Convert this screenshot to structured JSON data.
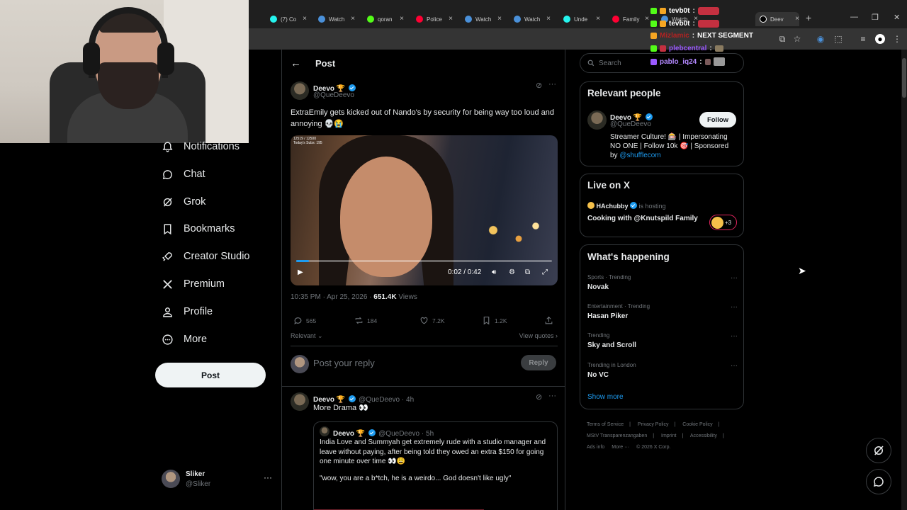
{
  "browser": {
    "tabs": [
      {
        "label": "(7) Co",
        "color": "#25f4ee"
      },
      {
        "label": "Watch",
        "color": "#53fc18"
      },
      {
        "label": "qoran",
        "color": "#53fc18"
      },
      {
        "label": "Police",
        "color": "#ff0033"
      },
      {
        "label": "Watch",
        "color": "#53fc18"
      },
      {
        "label": "Watch",
        "color": "#53fc18"
      },
      {
        "label": "Unde",
        "color": "#25f4ee"
      },
      {
        "label": "Family",
        "color": "#ff0033"
      },
      {
        "label": "Watch",
        "color": "#53fc18"
      },
      {
        "label": "Deev",
        "color": "#ffffff"
      }
    ]
  },
  "chat": [
    {
      "user": "tevb0t",
      "msg": "",
      "color": "#ffffff"
    },
    {
      "user": "tevb0t",
      "msg": "",
      "color": "#ffffff"
    },
    {
      "user": "Mizlamic",
      "msg": "NEXT SEGMENT",
      "color": "#b22222"
    },
    {
      "user": "plebcentral",
      "msg": "",
      "color": "#9b59ff"
    },
    {
      "user": "pablo_iq24",
      "msg": "",
      "color": "#b388ff"
    }
  ],
  "nav": {
    "notifications": "Notifications",
    "chat": "Chat",
    "grok": "Grok",
    "bookmarks": "Bookmarks",
    "creator_studio": "Creator Studio",
    "premium": "Premium",
    "profile": "Profile",
    "more": "More",
    "post_button": "Post"
  },
  "account": {
    "name": "Sliker",
    "handle": "@Sliker"
  },
  "main": {
    "header": "Post",
    "tweet": {
      "name": "Deevo 🏆",
      "handle": "@QueDeevo",
      "text": "ExtraEmily gets kicked out of Nando's by security for being way too loud and annoying 💀😭",
      "video_counter": "12519 / 12500",
      "video_subs": "Today's Subs: 195",
      "video_time": "0:02 / 0:42",
      "progress": 0.05,
      "timestamp": "10:35 PM · Apr 25, 2026 · ",
      "views": "651.4K",
      "views_label": " Views",
      "replies": "565",
      "reposts": "184",
      "likes": "7.2K",
      "bookmarks": "1.2K"
    },
    "sort_label": "Relevant",
    "view_quotes": "View quotes",
    "reply_placeholder": "Post your reply",
    "reply_button": "Reply",
    "reply_tweet": {
      "name": "Deevo 🏆",
      "handle": "@QueDeevo · 4h",
      "text": "More Drama 👀"
    },
    "quoted": {
      "name": "Deevo 🏆",
      "handle": "@QueDeevo · 5h",
      "text": "India Love and Summyah get extremely rude with a studio manager and leave without paying, after being told they owed an extra $150 for going one minute over time 👀😩",
      "quote_line": "\"wow, you are a b*tch, he is a weirdo... God doesn't like ugly\""
    }
  },
  "right": {
    "search_placeholder": "Search",
    "relevant_title": "Relevant people",
    "person": {
      "name": "Deevo 🏆",
      "handle": "@QueDeevo",
      "follow": "Follow",
      "bio": "Streamer Culture! 🎰 | Impersonating NO ONE | Follow 10k 🎯 | Sponsored by ",
      "bio_link": "@shufflecom"
    },
    "live_title": "Live on X",
    "live": {
      "host": "HAchubby",
      "hosting": "is hosting",
      "title": "Cooking with @Knutspild Family",
      "count": "+3"
    },
    "happening_title": "What's happening",
    "trends": [
      {
        "category": "Sports · Trending",
        "title": "Novak"
      },
      {
        "category": "Entertainment · Trending",
        "title": "Hasan Piker"
      },
      {
        "category": "Trending",
        "title": "Sky and Scroll"
      },
      {
        "category": "Trending in London",
        "title": "No VC"
      }
    ],
    "show_more": "Show more",
    "footer": [
      "Terms of Service",
      "Privacy Policy",
      "Cookie Policy",
      "MStV Transparenzangaben",
      "Imprint",
      "Accessibility",
      "Ads info",
      "More ···",
      "© 2026 X Corp."
    ]
  }
}
